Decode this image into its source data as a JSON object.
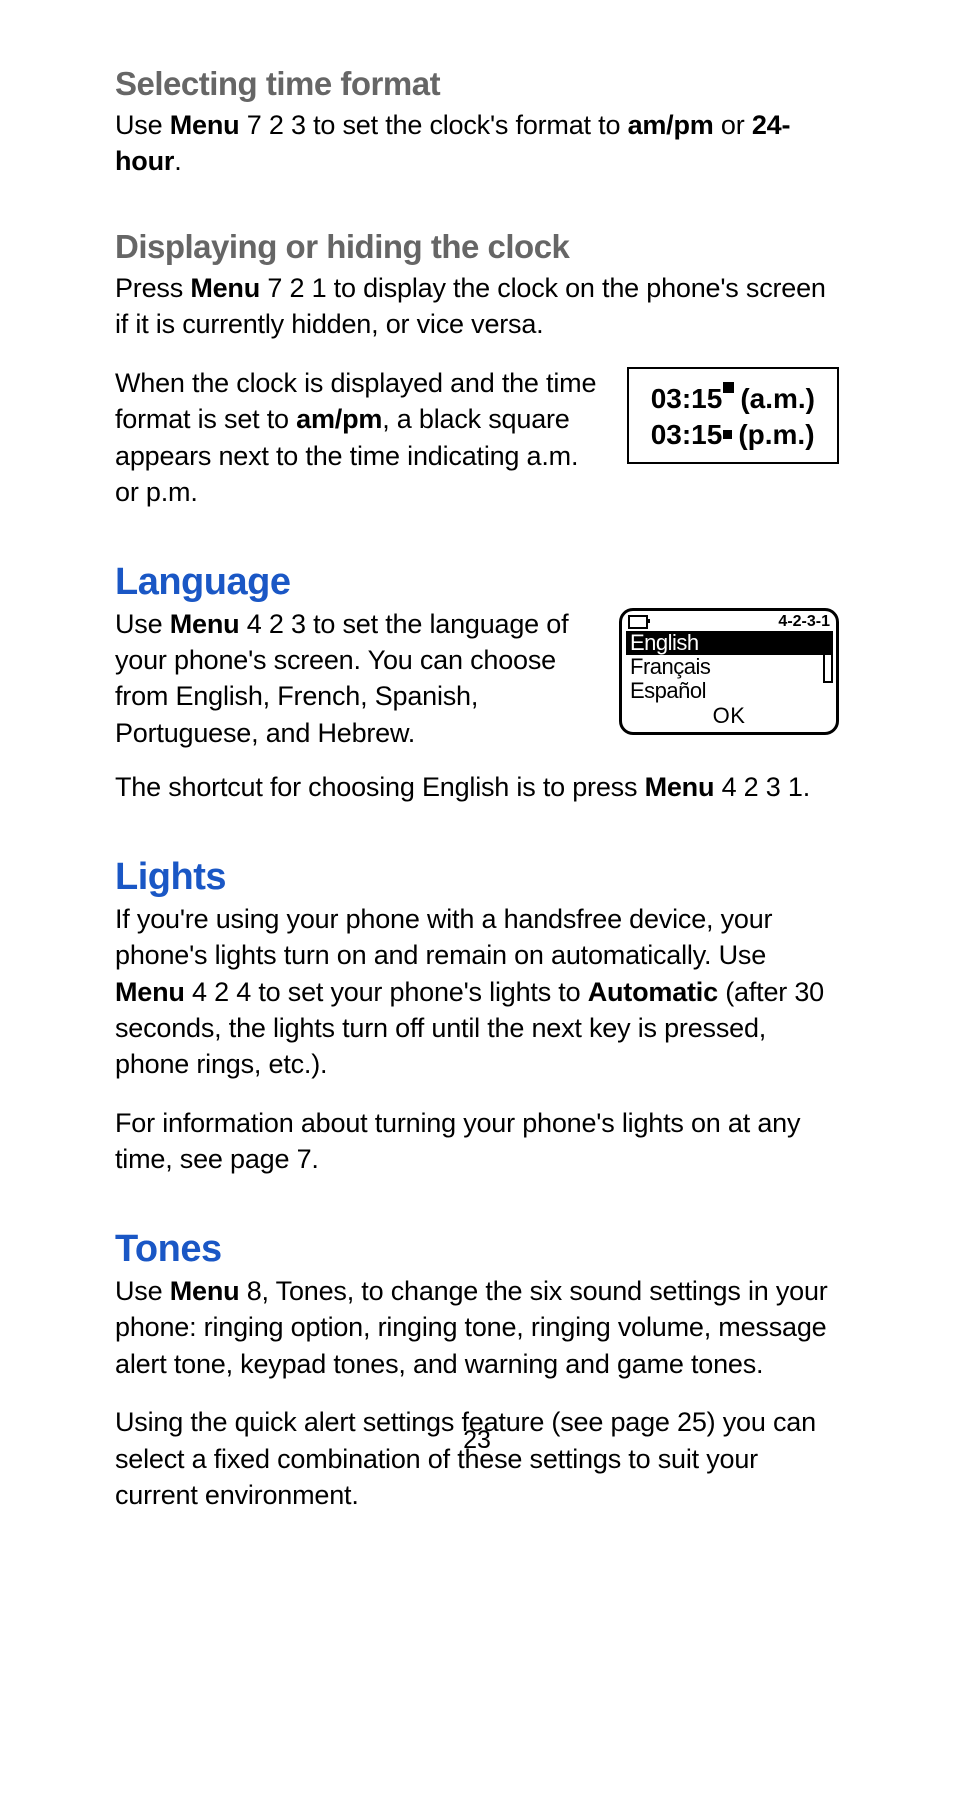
{
  "page_number": "23",
  "time_format": {
    "heading": "Selecting time format",
    "body_pre": "Use ",
    "body_menu": "Menu",
    "body_mid": " 7 2 3 to set the clock's format to ",
    "body_ampm": "am/pm",
    "body_or": " or ",
    "body_24h": "24-hour",
    "body_end": "."
  },
  "display_clock": {
    "heading": "Displaying or hiding the clock",
    "p1_pre": "Press ",
    "p1_menu": "Menu",
    "p1_rest": " 7 2 1 to display the clock on the phone's screen if it is currently hidden, or vice versa.",
    "p2_pre": "When the clock is displayed and the time format is set to ",
    "p2_bold": "am/pm",
    "p2_rest": ", a black square appears next to the time indicating a.m. or p.m."
  },
  "clock_box": {
    "time": "03:15",
    "am": "(a.m.)",
    "pm": "(p.m.)"
  },
  "language": {
    "heading": "Language",
    "p1_pre": "Use ",
    "p1_menu": "Menu",
    "p1_rest": " 4 2 3 to set the language of your phone's screen. You can choose from English, French, Spanish, Portuguese, and Hebrew.",
    "p2_pre": "The shortcut for choosing English is to press ",
    "p2_menu": "Menu",
    "p2_rest": " 4 2 3 1."
  },
  "language_screen": {
    "index": "4-2-3-1",
    "items": [
      "English",
      "Français",
      "Español"
    ],
    "selected": 0,
    "ok_label": "OK"
  },
  "lights": {
    "heading": "Lights",
    "p1_a": "If you're using your phone with a handsfree device, your phone's lights turn on and remain on automatically. Use ",
    "p1_menu": "Menu",
    "p1_b": " 4 2 4 to set your phone's lights to ",
    "p1_auto": "Automatic",
    "p1_c": " (after 30 seconds, the lights turn off until the next key is pressed, phone rings, etc.).",
    "p2": "For information about turning your phone's lights on at any time, see page 7."
  },
  "tones": {
    "heading": "Tones",
    "p1_pre": "Use ",
    "p1_menu": "Menu",
    "p1_rest": " 8, Tones, to change the six sound settings in your phone: ringing option, ringing tone, ringing volume, message alert tone, keypad tones, and warning and game tones.",
    "p2": "Using the quick alert settings feature (see page 25) you can select a fixed combination of these settings to suit your current environment."
  }
}
